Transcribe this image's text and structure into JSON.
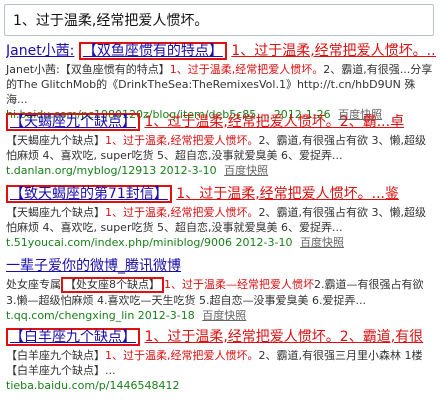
{
  "search": {
    "query": "1、过于温柔,经常把爱人惯坏。"
  },
  "results": [
    {
      "title_prefix": "Janet小茜:",
      "title_boxed": "【双鱼座惯有的特点】",
      "title_rest": "1、过于温柔,经常把爱人惯坏。...",
      "desc_a": "Janet小茜:【双鱼座惯有的特点】",
      "desc_hl": "1、过于温柔,经常把爱人惯坏。",
      "desc_b": "2、霸道,有很强...分享的The GlitchMob的《DrinkTheSea:TheRemixesVol.1》http://t.cn/hbD9UN 殊海...",
      "url": "hi.baidu.com/pc1980120z/blog/item/deb5c85 ... 2012-1-26",
      "cache": "百度快照"
    },
    {
      "title_boxed": "【天蝎座九个缺点】",
      "title_rest": "1、过于温柔,经常把爱人惯坏。2、霸...卓",
      "desc_a": "【天蝎座九个缺点】",
      "desc_hl": "1、过于温柔,经常把爱人惯坏。",
      "desc_b": "2、霸道,有很强占有欲 3、懒,超级怕麻烦 4、喜欢吃, super吃货 5、超自恋,没事就爱臭美 6、爱捉弄...",
      "url": "t.danlan.org/myblog/12913 2012-3-10",
      "cache": "百度快照"
    },
    {
      "title_boxed": "【致天蝎座的第71封信】",
      "title_rest": "1、过于温柔,经常把爱人惯坏。...鉴",
      "desc_a": "【天蝎座九个缺点】",
      "desc_hl": "1、过于温柔,经常把爱人惯坏。",
      "desc_b": "2、霸道,有很强占有欲 3、懒,超级怕麻烦 4、喜欢吃, super吃货 5、超自恋,没事就爱臭美 6、爱捉弄...",
      "url": "t.51youcai.com/index.php/miniblog/9006 2012-3-10",
      "cache": "百度快照"
    },
    {
      "title_plain": "一辈子爱你的微博_腾讯微博",
      "desc_a": "处女座专属",
      "desc_boxed": "【处女座8个缺点】",
      "desc_hl": "1、过于温柔—经常把爱人惯坏",
      "desc_b": "2.霸道—有很强占有欲 3.懒—超级怕麻烦 4.喜欢吃—天生吃货 5.超自恋—没事爱臭美 6.爱捉弄...",
      "url": "t.qq.com/chengxing_lin 2012-3-18",
      "cache": "百度快照"
    },
    {
      "title_boxed": "【白羊座九个缺点】",
      "title_rest": "1、过于温柔,经常把爱人惯坏。2、霸道,有很",
      "desc_a": "【白羊座九个缺点】",
      "desc_hl": "1、过于温柔,经常把爱人惯坏。",
      "desc_b": "2、霸道,有很强三月里小森林 1楼【白羊座九个缺点】...",
      "url": "tieba.baidu.com/p/1446548412",
      "cache": ""
    }
  ]
}
